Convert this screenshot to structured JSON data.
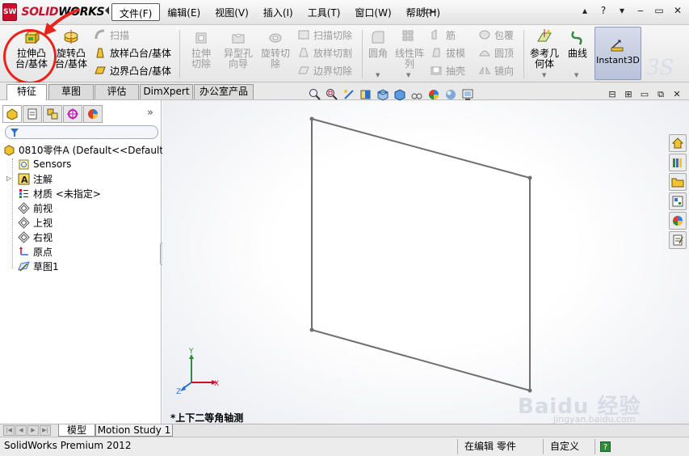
{
  "app": {
    "brand_short": "SW",
    "brand_red": "SOLID",
    "brand_black": "WORKS",
    "status_app": "SolidWorks Premium 2012"
  },
  "menu": [
    "文件(F)",
    "编辑(E)",
    "视图(V)",
    "插入(I)",
    "工具(T)",
    "窗口(W)",
    "帮助(H)"
  ],
  "menu_active_index": 0,
  "window_controls": {
    "help": "?",
    "minimize": "‒",
    "restore": "▭",
    "close": "✕"
  },
  "commands": {
    "extrude": "拉伸凸台/基体",
    "revolve": "旋转凸台/基体",
    "sweep": "扫描",
    "loft": "放样凸台/基体",
    "boundary": "边界凸台/基体",
    "extrude_cut": "拉伸切除",
    "hole_wizard": "异型孔向导",
    "revolve_cut": "旋转切除",
    "swept_cut": "扫描切除",
    "lofted_cut": "放样切割",
    "boundary_cut": "边界切除",
    "fillet": "圆角",
    "linear_pattern": "线性阵列",
    "rib": "筋",
    "draft": "拔模",
    "shell": "抽壳",
    "wrap": "包覆",
    "dome": "圆顶",
    "mirror": "镜向",
    "ref_geometry": "参考几何体",
    "curves": "曲线",
    "instant3d": "Instant3D"
  },
  "cm_tabs": [
    "特征",
    "草图",
    "评估",
    "DimXpert",
    "办公室产品"
  ],
  "cm_tab_active": 0,
  "tree": {
    "root": "0810零件A  (Default<<Default",
    "items": [
      "Sensors",
      "注解",
      "材质 <未指定>",
      "前视",
      "上视",
      "右视",
      "原点",
      "草图1"
    ]
  },
  "graphics": {
    "view_label": "*上下二等角轴测",
    "triad": {
      "x": "X",
      "y": "Y",
      "z": "Z"
    }
  },
  "bottom_tabs": [
    "模型",
    "Motion Study 1"
  ],
  "bottom_tab_active": 0,
  "status": {
    "mode": "在编辑 零件",
    "units": "自定义",
    "help": "?"
  },
  "watermark": {
    "text": "Baidu 经验",
    "url": "jingyan.baidu.com"
  },
  "colors": {
    "brand_red": "#c8102e",
    "annotation_red": "#e8231c",
    "instant3d_active": "#c3cbe0"
  }
}
